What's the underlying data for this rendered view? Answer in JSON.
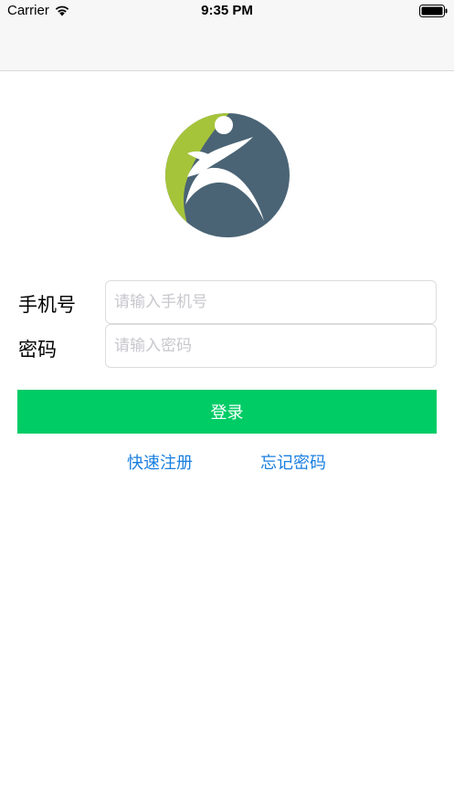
{
  "status_bar": {
    "carrier": "Carrier",
    "time": "9:35 PM"
  },
  "form": {
    "phone_label": "手机号",
    "phone_placeholder": "请输入手机号",
    "password_label": "密码",
    "password_placeholder": "请输入密码"
  },
  "actions": {
    "login_label": "登录",
    "register_link": "快速注册",
    "forgot_link": "忘记密码"
  },
  "colors": {
    "login_button": "#00cc66",
    "link": "#1a7fe0",
    "logo_circle": "#4a6475",
    "logo_accent": "#a6c43a"
  }
}
